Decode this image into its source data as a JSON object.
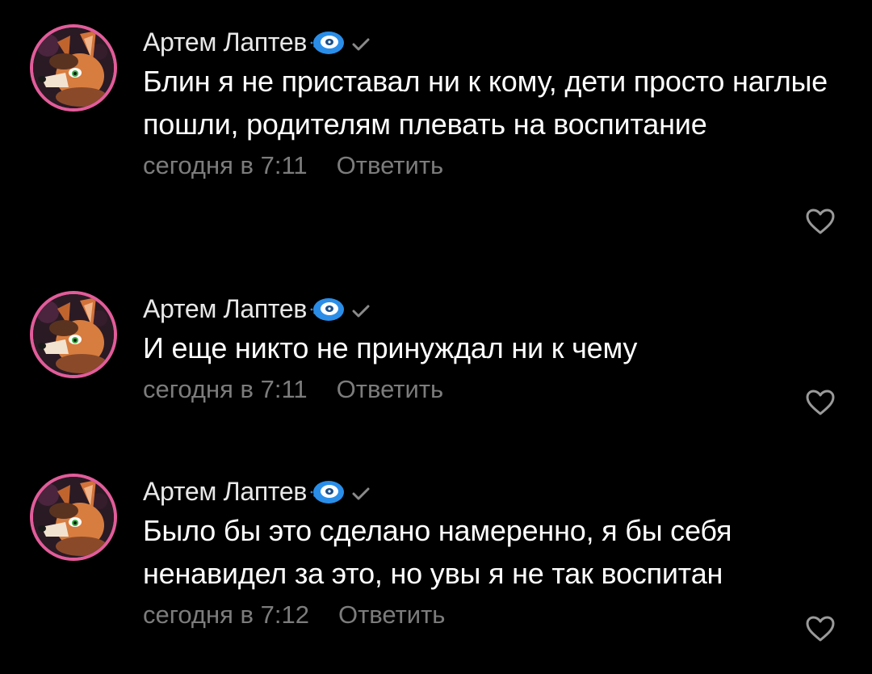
{
  "comments": [
    {
      "author": "Артем Лаптев",
      "text": "Блин я не приставал ни к кому, дети просто наглые пошли, родителям плевать на воспитание",
      "time": "сегодня в 7:11",
      "reply_label": "Ответить"
    },
    {
      "author": "Артем Лаптев",
      "text": "И еще никто не принуждал ни к чему",
      "time": "сегодня в 7:11",
      "reply_label": "Ответить"
    },
    {
      "author": "Артем Лаптев",
      "text": "Было бы это сделано намеренно, я бы себя ненавидел за это, но увы я не так воспитан",
      "time": "сегодня в 7:12",
      "reply_label": "Ответить"
    }
  ],
  "icons": {
    "badge": "blue-disc-badge-icon",
    "verified": "checkmark-icon",
    "like": "heart-outline-icon"
  },
  "colors": {
    "background": "#000000",
    "avatar_ring": "#e25c9a",
    "badge_blue": "#2a8ee8",
    "muted_text": "#7c7c7c"
  }
}
